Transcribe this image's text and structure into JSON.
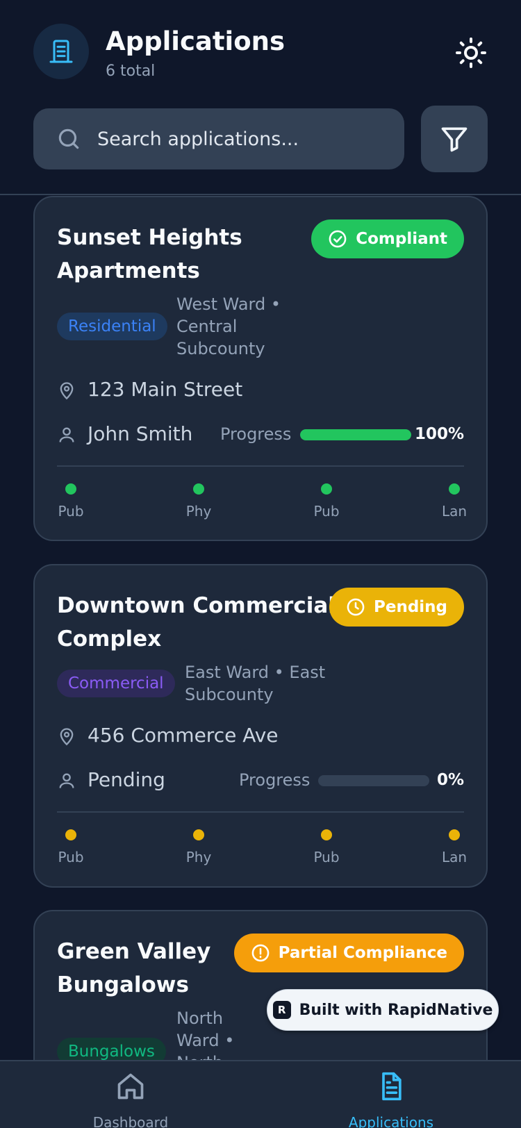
{
  "header": {
    "title": "Applications",
    "count_text": "6 total",
    "search_placeholder": "Search applications..."
  },
  "applications": [
    {
      "name_line1": "Sunset Heights",
      "name_line2": "Apartments",
      "status": "Compliant",
      "status_color": "#22c55e",
      "type": "Residential",
      "ward_lines": [
        "West Ward •",
        "Central",
        "Subcounty"
      ],
      "address": "123 Main Street",
      "owner": "John Smith",
      "progress_label": "Progress",
      "progress": 1.0,
      "progress_text": "100%",
      "checks": [
        "Pub",
        "Phy",
        "Pub",
        "Lan"
      ],
      "check_color": "#22c55e"
    },
    {
      "name_line1": "Downtown Commercial",
      "name_line2": "Complex",
      "status": "Pending",
      "status_color": "#eab308",
      "type": "Commercial",
      "ward_lines": [
        "East Ward • East",
        "Subcounty"
      ],
      "address": "456 Commerce Ave",
      "owner": "Pending",
      "progress_label": "Progress",
      "progress": 0.0,
      "progress_text": "0%",
      "checks": [
        "Pub",
        "Phy",
        "Pub",
        "Lan"
      ],
      "check_color": "#eab308"
    },
    {
      "name_line1": "Green Valley",
      "name_line2": "Bungalows",
      "status": "Partial Compliance",
      "status_color": "#f59e0b",
      "type": "Bungalows",
      "ward_lines": [
        "North",
        "Ward •",
        "North"
      ]
    }
  ],
  "built_with": "Built with RapidNative",
  "nav": {
    "dashboard": "Dashboard",
    "applications": "Applications",
    "active_color": "#38bdf8"
  },
  "icons": {
    "app": "building-icon",
    "theme": "sun-icon",
    "search": "search-icon",
    "filter": "filter-icon",
    "location": "map-pin-icon",
    "person": "user-icon"
  }
}
